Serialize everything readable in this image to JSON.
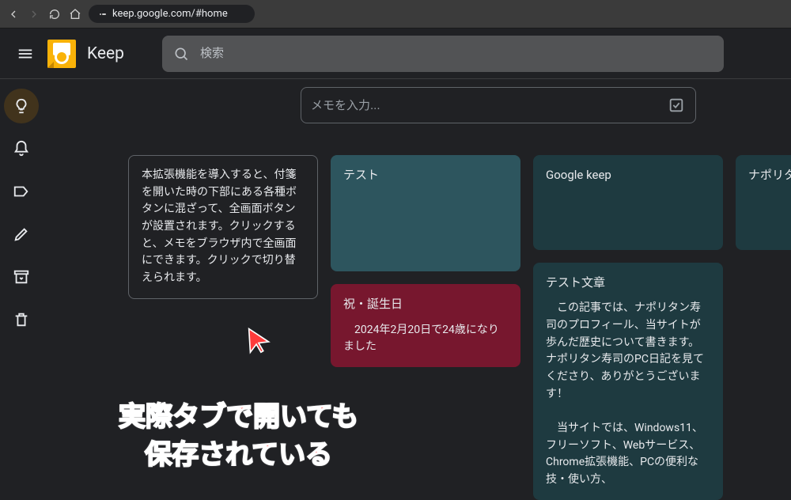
{
  "browser": {
    "url": "keep.google.com/#home"
  },
  "header": {
    "app_title": "Keep",
    "search_placeholder": "検索"
  },
  "take_note": {
    "placeholder": "メモを入力..."
  },
  "sidebar": {
    "items": [
      {
        "name": "lightbulb-icon",
        "active": true
      },
      {
        "name": "bell-icon",
        "active": false
      },
      {
        "name": "label-icon",
        "active": false
      },
      {
        "name": "pencil-icon",
        "active": false
      },
      {
        "name": "archive-icon",
        "active": false
      },
      {
        "name": "trash-icon",
        "active": false
      }
    ]
  },
  "notes": {
    "col1": {
      "n1": {
        "body": "本拡張機能を導入すると、付箋を開いた時の下部にある各種ボタンに混ざって、全画面ボタンが設置されます。クリックすると、メモをブラウザ内で全画面にできます。クリックで切り替えられます。"
      }
    },
    "col2": {
      "n1": {
        "title": "テスト"
      },
      "n2": {
        "title": "祝・誕生日",
        "body": "　2024年2月20日で24歳になりました"
      }
    },
    "col3": {
      "n1": {
        "title": "Google keep"
      },
      "n2": {
        "title": "テスト文章",
        "body": "　この記事では、ナポリタン寿司のプロフィール、当サイトが歩んだ歴史について書きます。ナポリタン寿司のPC日記を見てくださり、ありがとうございます！\n\n　当サイトでは、Windows11、フリーソフト、Webサービス、Chrome拡張機能、PCの便利な技・使い方、"
      }
    },
    "col4": {
      "n1": {
        "title": "ナポリタ"
      }
    }
  },
  "annotation": {
    "text": "実際タブで開いても\n保存されている"
  }
}
